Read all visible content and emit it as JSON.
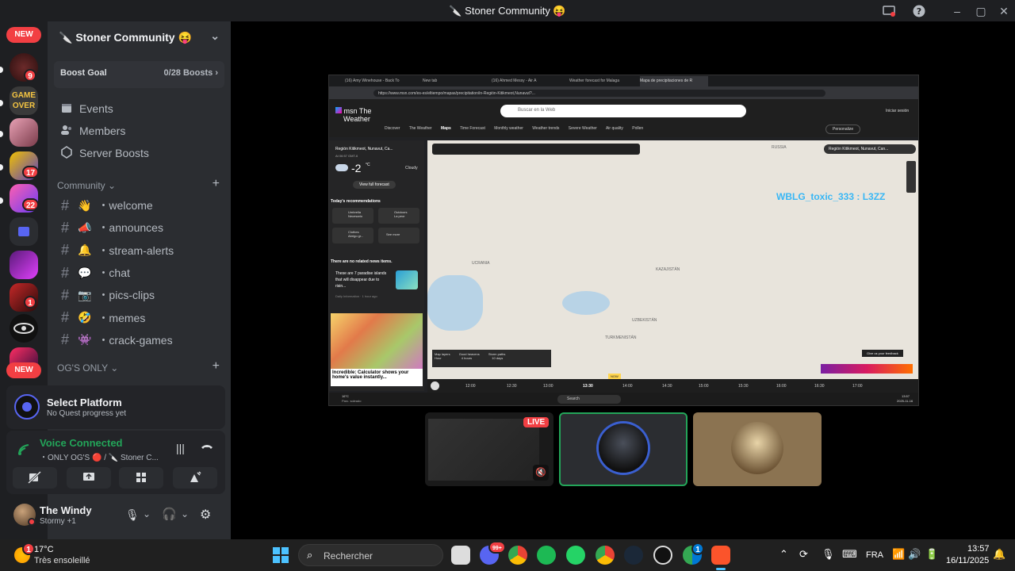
{
  "window": {
    "title": "🔪 Stoner Community 😝"
  },
  "rail": {
    "new_top": "NEW",
    "new_bottom": "NEW",
    "badges": [
      "9",
      "17",
      "22",
      "1"
    ],
    "game_over_label": "GAME OVER"
  },
  "sidebar": {
    "server_name": "🔪 Stoner Community 😝",
    "boost_label": "Boost Goal",
    "boost_value": "0/28 Boosts",
    "menu": [
      {
        "label": "Events"
      },
      {
        "label": "Members"
      },
      {
        "label": "Server Boosts"
      }
    ],
    "category_1": "Community",
    "channels": [
      {
        "emoji": "👋",
        "name": "・welcome"
      },
      {
        "emoji": "📣",
        "name": "・announces"
      },
      {
        "emoji": "🔔",
        "name": "・stream-alerts"
      },
      {
        "emoji": "💬",
        "name": "・chat"
      },
      {
        "emoji": "📷",
        "name": "・pics-clips"
      },
      {
        "emoji": "🤣",
        "name": "・memes"
      },
      {
        "emoji": "👾",
        "name": "・crack-games"
      }
    ],
    "category_2": "OG'S ONLY"
  },
  "quest": {
    "title": "Select Platform",
    "subtitle": "No Quest progress yet"
  },
  "voice": {
    "status": "Voice Connected",
    "channel": "・ONLY OG'S 🔴 / 🔪 Stoner C..."
  },
  "user": {
    "name": "The Windy",
    "status": "Stormy +1"
  },
  "stream": {
    "browser_tabs": [
      "(16) Amy Winehouse - Back To",
      "New tab",
      "(16) Ahmed Messy - Air A",
      "Weather forecast for Malaga",
      "Mapa de precipitaciones de R"
    ],
    "url": "https://www.msn.com/es-es/eltiempo/mapas/precipitation/in-Región-Kitikmeot,Nunavut?...",
    "app_title_1": "msn The",
    "app_title_2": "Weather",
    "search_placeholder": "Buscar en la Web",
    "signin": "Iniciar sesión",
    "nav": [
      "Discover",
      "The Weather",
      "Maps",
      "Time Forecast",
      "Monthly weather",
      "Weather trends",
      "Severe Weather",
      "Air quality",
      "Pollen"
    ],
    "personalize": "Personalize",
    "location": "Región Kitikmeot, Nunavut, Ca...",
    "time_note": "At 06:57 GMT-6",
    "temp": "-2",
    "unit": "°C",
    "condition": "Cloudy",
    "full_forecast": "View full forecast",
    "recommendations_title": "Today's recommendations",
    "rec": [
      "Umbrella",
      "Outdoors",
      "Clothes",
      "See more"
    ],
    "rec_sub": [
      "Necesario",
      "La peor",
      "Abrigo gr..."
    ],
    "news_title": "There are no related news items.",
    "news_story": "These are 7 paradise islands that will disappear due to risin...",
    "news_source": "Daily Information · 1 hour ago",
    "ad_text": "Incredible: Calculator shows your home's value instantly...",
    "map_search": "Región Kitikmeot, Nunavut, Can...",
    "map_labels": [
      "RUSSIA",
      "UCRANIA",
      "KAZAJISTÁN",
      "UZBEKISTÁN",
      "TURKMENISTÁN"
    ],
    "overlay_name": "WBLG_toxic_333 : L3ZZ",
    "map_layers": [
      "Map layers",
      "Good heavens",
      "Storm paths"
    ],
    "map_range": [
      "Hour",
      "4 hours",
      "10 days"
    ],
    "feedback": "Give us your feedback",
    "timeline": [
      "12:00",
      "12:30",
      "13:00",
      "13:30",
      "14:00",
      "14:30",
      "15:00",
      "15:30",
      "16:00",
      "16:30",
      "17:00"
    ],
    "now": "NOW",
    "inner_taskbar_search": "Search",
    "inner_time": "13:57",
    "inner_date": "2025-11-16",
    "inner_weather": "16°C",
    "inner_weather_sub": "Parc. soleado"
  },
  "tiles": {
    "live": "LIVE"
  },
  "taskbar": {
    "weather_temp": "17°C",
    "weather_desc": "Très ensoleillé",
    "weather_badge": "1",
    "search": "Rechercher",
    "lang": "FRA",
    "time": "13:57",
    "date": "16/11/2025",
    "discord_badge": "99+",
    "edge_badge": "1"
  }
}
